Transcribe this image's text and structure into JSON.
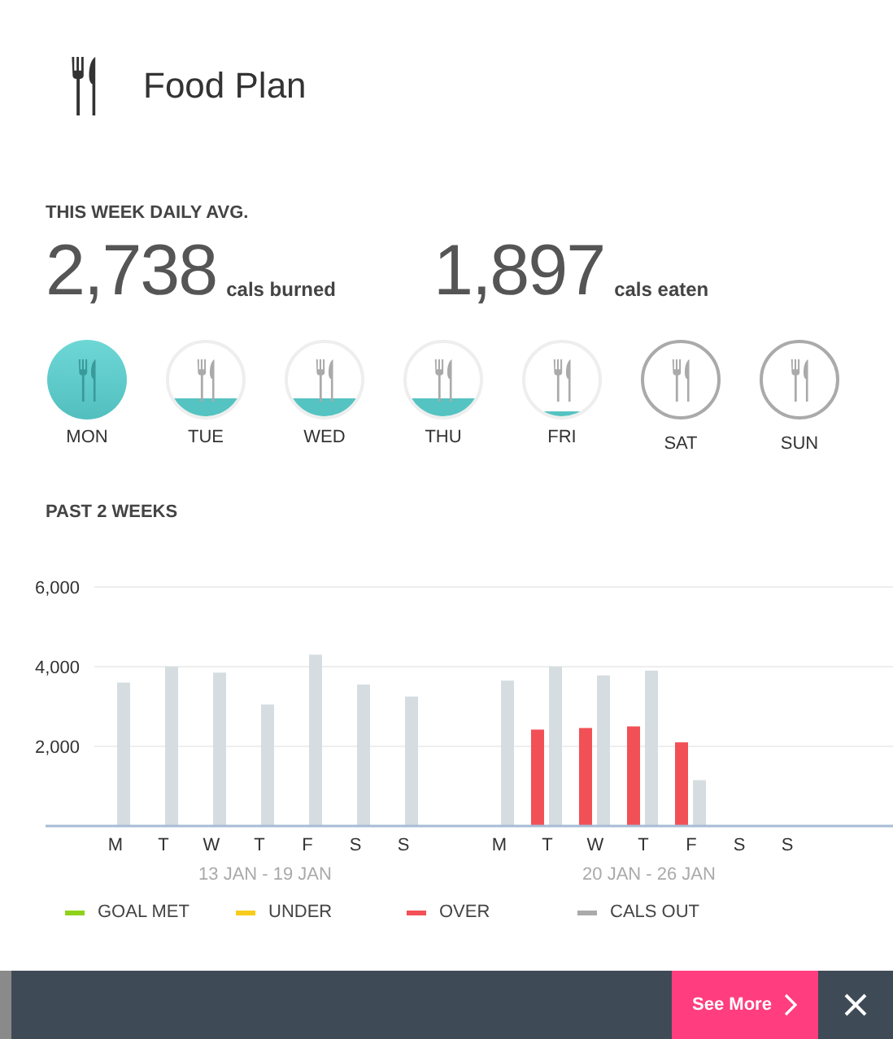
{
  "header": {
    "title": "Food Plan"
  },
  "summary": {
    "heading": "THIS WEEK DAILY AVG.",
    "stats": [
      {
        "value": "2,738",
        "unit": "cals burned"
      },
      {
        "value": "1,897",
        "unit": "cals eaten"
      }
    ]
  },
  "days": [
    {
      "label": "MON",
      "kind": "full",
      "selected": true
    },
    {
      "label": "TUE",
      "kind": "partial",
      "selected": false
    },
    {
      "label": "WED",
      "kind": "partial",
      "selected": false
    },
    {
      "label": "THU",
      "kind": "partial",
      "selected": false
    },
    {
      "label": "FRI",
      "kind": "trace",
      "selected": false
    },
    {
      "label": "SAT",
      "kind": "future",
      "selected": false
    },
    {
      "label": "SUN",
      "kind": "future",
      "selected": false
    }
  ],
  "history": {
    "heading": "PAST 2 WEEKS",
    "chart_data": {
      "type": "bar",
      "categories": [
        "M",
        "T",
        "W",
        "T",
        "F",
        "S",
        "S",
        "M",
        "T",
        "W",
        "T",
        "F",
        "S",
        "S"
      ],
      "ylim": [
        0,
        6000
      ],
      "yticks": [
        {
          "value": 2000,
          "label": "2,000"
        },
        {
          "value": 4000,
          "label": "4,000"
        },
        {
          "value": 6000,
          "label": "6,000"
        }
      ],
      "series": [
        {
          "name": "OVER",
          "color": "#f25057",
          "values": [
            null,
            null,
            null,
            null,
            null,
            null,
            null,
            null,
            2420,
            2460,
            2500,
            2100,
            null,
            null
          ]
        },
        {
          "name": "CALS OUT",
          "color": "#d5dde1",
          "values": [
            3600,
            4000,
            3850,
            3050,
            4300,
            3550,
            3250,
            3650,
            4000,
            3780,
            3900,
            1150,
            null,
            null
          ]
        }
      ]
    },
    "weeks": [
      "13 JAN - 19 JAN",
      "20 JAN - 26 JAN"
    ],
    "legend": [
      {
        "label": "GOAL MET",
        "color": "#8fd21b"
      },
      {
        "label": "UNDER",
        "color": "#f7cc1c"
      }
    ]
  },
  "footer": {
    "button": "See More"
  }
}
